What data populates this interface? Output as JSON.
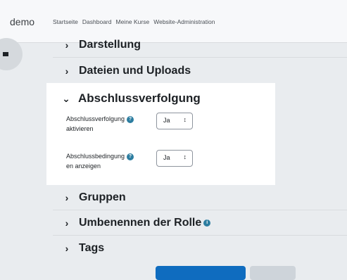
{
  "navbar": {
    "brand": "demo",
    "links": [
      "Startseite",
      "Dashboard",
      "Meine Kurse",
      "Website-Administration"
    ]
  },
  "sections": {
    "darstellung": "Darstellung",
    "dateien": "Dateien und Uploads",
    "abschluss": "Abschlussverfolgung",
    "gruppen": "Gruppen",
    "umbenennen": "Umbenennen der Rolle",
    "tags": "Tags"
  },
  "fields": {
    "aktivieren": {
      "label_line1": "Abschlussverfolgung",
      "label_line2": "aktivieren",
      "value": "Ja"
    },
    "anzeigen": {
      "label_line1": "Abschlussbedingung",
      "label_line2": "en anzeigen",
      "value": "Ja"
    }
  },
  "icons": {
    "collapsed": "chevron-right-icon",
    "expanded": "chevron-down-icon",
    "help": "question-circle-icon",
    "info": "info-circle-icon",
    "select": "updown-caret-icon"
  },
  "colors": {
    "help_icon": "#2c7da0",
    "primary_button": "#0f6cbf",
    "secondary_button": "#ced4da",
    "page_background": "#e9ecef",
    "card_background": "#ffffff"
  }
}
